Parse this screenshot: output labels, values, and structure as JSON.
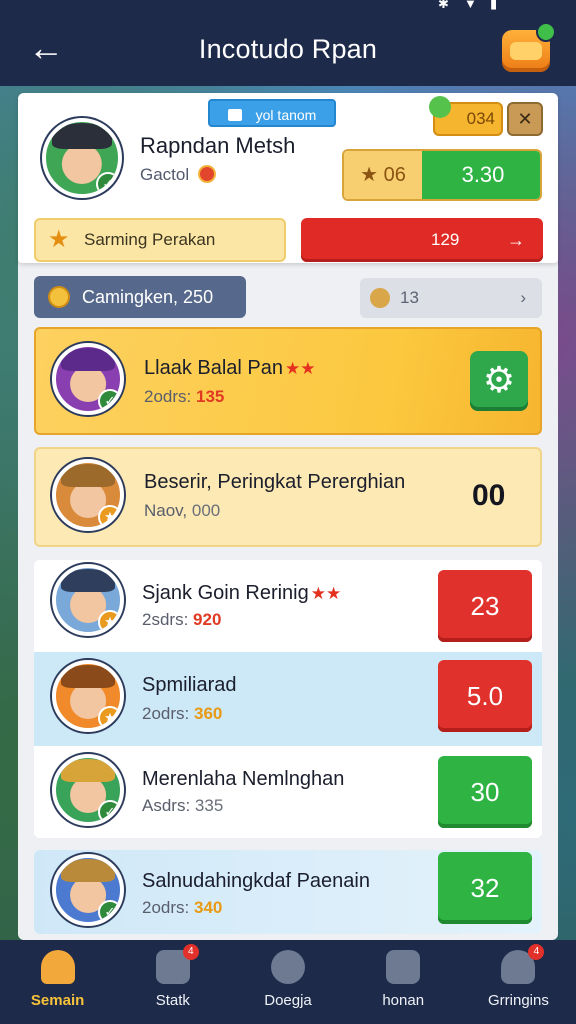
{
  "header": {
    "title": "Incotudo Rpan",
    "back_icon": "arrow-left-icon",
    "chest_icon": "treasure-chest-icon"
  },
  "profile": {
    "name": "Rapndan Metsh",
    "subtitle": "Gactol",
    "tag": "yol tanom",
    "coins": "034",
    "score_left": "06",
    "score_right": "3.30"
  },
  "banner": {
    "text": "Sarming Perakan",
    "red_value": "129",
    "arrow": "→"
  },
  "filters": {
    "primary": "Camingken, 250",
    "secondary": "13",
    "arrow": "›"
  },
  "entries": [
    {
      "name": "Llaak Balal Pan",
      "stars": "★★",
      "score_label": "2odrs:",
      "score_value": "135",
      "action": "settings"
    },
    {
      "name": "Beserir, Peringkat Pererghian",
      "score_label": "Naov,",
      "score_value": "000",
      "value": "00"
    },
    {
      "name": "Sjank Goin Rerinig",
      "stars": "★★",
      "score_label": "2sdrs:",
      "score_value": "920",
      "value": "23"
    },
    {
      "name": "Spmiliarad",
      "score_label": "2odrs:",
      "score_value": "360",
      "value": "5.0"
    },
    {
      "name": "Merenlaha Nemlnghan",
      "score_label": "Asdrs:",
      "score_value": "335",
      "value": "30"
    },
    {
      "name": "Salnudahingkdaf Paenain",
      "score_label": "2odrs:",
      "score_value": "340",
      "value": "32"
    }
  ],
  "nav": [
    {
      "label": "Semain",
      "icon": "home-hut-icon",
      "active": true
    },
    {
      "label": "Statk",
      "icon": "grid-stats-icon",
      "badge": "4"
    },
    {
      "label": "Doegja",
      "icon": "map-pin-icon"
    },
    {
      "label": "honan",
      "icon": "gift-box-icon"
    },
    {
      "label": "Grringins",
      "icon": "profile-icon",
      "badge": "4"
    }
  ],
  "colors": {
    "header_bg": "#1e2a4a",
    "accent_green": "#2fb444",
    "accent_red": "#e1312c",
    "accent_gold": "#f8c23a"
  }
}
